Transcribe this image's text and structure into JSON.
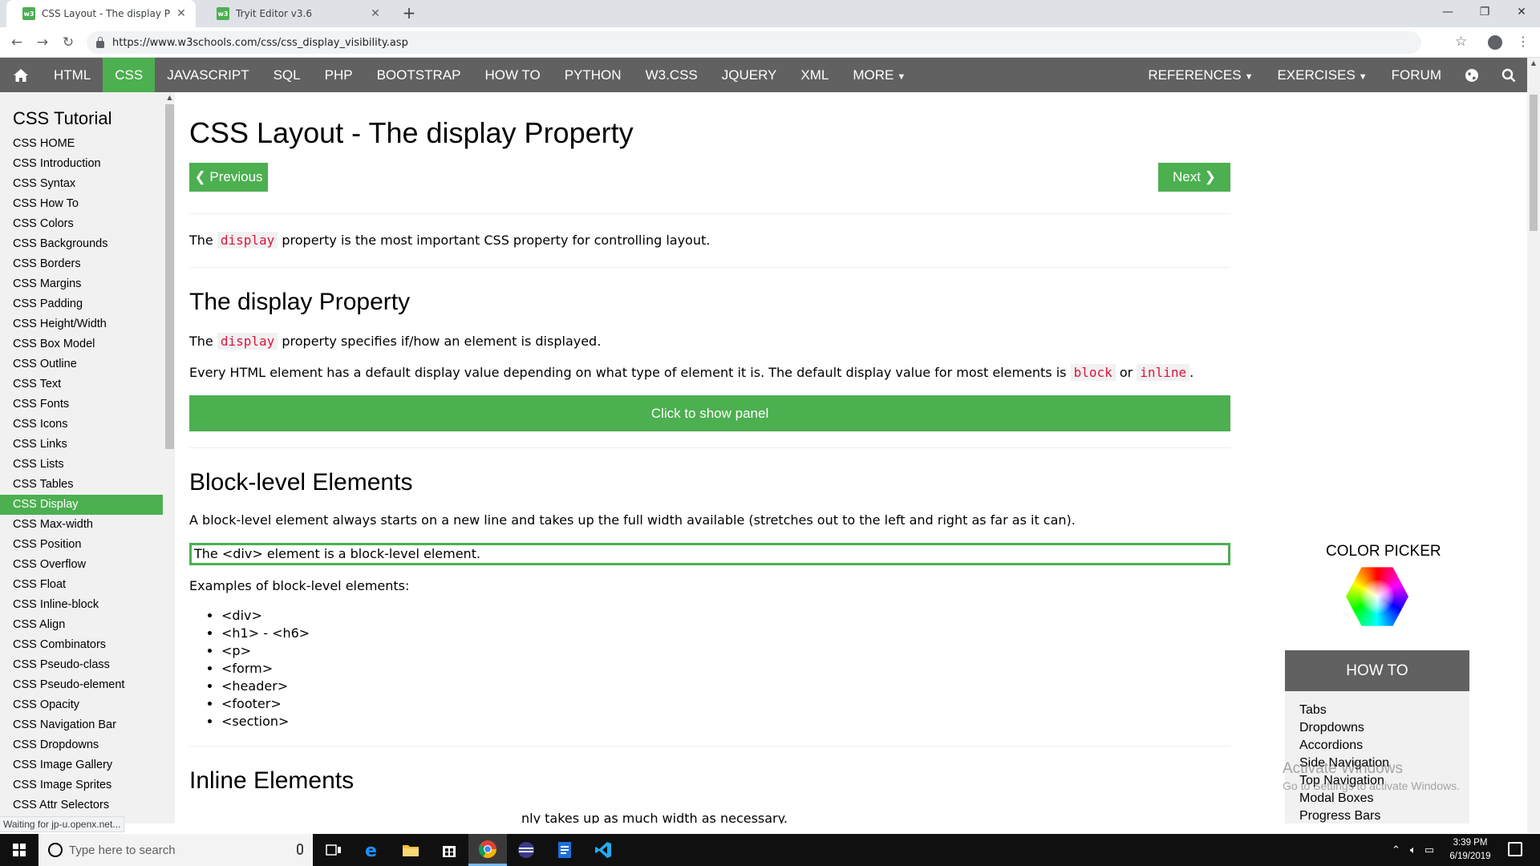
{
  "browser": {
    "tabs": [
      {
        "title": "CSS Layout - The display Propert",
        "favicon": "w3"
      },
      {
        "title": "Tryit Editor v3.6",
        "favicon": "w3"
      }
    ],
    "url": "https://www.w3schools.com/css/css_display_visibility.asp",
    "status_text": "Waiting for jp-u.openx.net..."
  },
  "topnav": {
    "items": [
      "HTML",
      "CSS",
      "JAVASCRIPT",
      "SQL",
      "PHP",
      "BOOTSTRAP",
      "HOW TO",
      "PYTHON",
      "W3.CSS",
      "JQUERY",
      "XML",
      "MORE"
    ],
    "active": "CSS",
    "right_items": [
      "REFERENCES",
      "EXERCISES",
      "FORUM"
    ],
    "accent_color": "#4caf50",
    "bar_color": "#616161"
  },
  "sidebar": {
    "title": "CSS Tutorial",
    "items": [
      "CSS HOME",
      "CSS Introduction",
      "CSS Syntax",
      "CSS How To",
      "CSS Colors",
      "CSS Backgrounds",
      "CSS Borders",
      "CSS Margins",
      "CSS Padding",
      "CSS Height/Width",
      "CSS Box Model",
      "CSS Outline",
      "CSS Text",
      "CSS Fonts",
      "CSS Icons",
      "CSS Links",
      "CSS Lists",
      "CSS Tables",
      "CSS Display",
      "CSS Max-width",
      "CSS Position",
      "CSS Overflow",
      "CSS Float",
      "CSS Inline-block",
      "CSS Align",
      "CSS Combinators",
      "CSS Pseudo-class",
      "CSS Pseudo-element",
      "CSS Opacity",
      "CSS Navigation Bar",
      "CSS Dropdowns",
      "CSS Image Gallery",
      "CSS Image Sprites",
      "CSS Attr Selectors"
    ],
    "active": "CSS Display"
  },
  "main": {
    "title": "CSS Layout - The display Property",
    "prev_label": "❮ Previous",
    "next_label": "Next ❯",
    "intro": {
      "before": "The ",
      "code": "display",
      "after": " property is the most important CSS property for controlling layout."
    },
    "section1_title": "The display Property",
    "s1_p1": {
      "before": "The ",
      "code": "display",
      "after": " property specifies if/how an element is displayed."
    },
    "s1_p2": {
      "text": "Every HTML element has a default display value depending on what type of element it is. The default display value for most elements is ",
      "code1": "block",
      "or": " or ",
      "code2": "inline",
      "end": "."
    },
    "panel_button": "Click to show panel",
    "section2_title": "Block-level Elements",
    "s2_p1": "A block-level element always starts on a new line and takes up the full width available (stretches out to the left and right as far as it can).",
    "div_demo": "The <div> element is a block-level element.",
    "examples_label": "Examples of block-level elements:",
    "block_examples": [
      "<div>",
      "<h1> - <h6>",
      "<p>",
      "<form>",
      "<header>",
      "<footer>",
      "<section>"
    ],
    "section3_title": "Inline Elements",
    "s3_p1_partial": "nly takes up as much width as necessary."
  },
  "right_column": {
    "color_picker_title": "COLOR PICKER",
    "howto_title": "HOW TO",
    "howto_items": [
      "Tabs",
      "Dropdowns",
      "Accordions",
      "Side Navigation",
      "Top Navigation",
      "Modal Boxes",
      "Progress Bars"
    ]
  },
  "watermark": {
    "title": "Activate Windows",
    "subtitle": "Go to Settings to activate Windows."
  },
  "taskbar": {
    "search_placeholder": "Type here to search",
    "time": "3:39 PM",
    "date": "6/19/2019"
  }
}
